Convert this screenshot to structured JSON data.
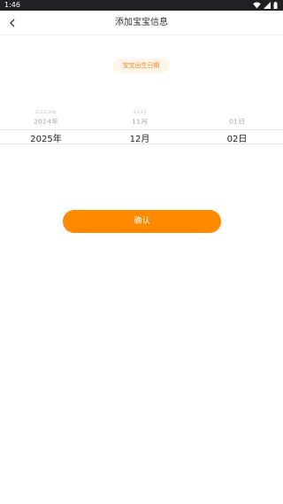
{
  "status_bar": {
    "time": "1:46"
  },
  "header": {
    "title": "添加宝宝信息"
  },
  "chip": {
    "label": "宝宝出生日期"
  },
  "picker": {
    "year": {
      "above2": "2023年",
      "above1": "2024年",
      "selected": "2025年"
    },
    "month": {
      "above2": "10月",
      "above1": "11月",
      "selected": "12月"
    },
    "day": {
      "above2": "",
      "above1": "01日",
      "selected": "02日"
    }
  },
  "confirm": {
    "label": "确认"
  },
  "colors": {
    "accent": "#ff8a00",
    "chip_bg": "#fff4ea",
    "chip_text": "#f0871f"
  }
}
